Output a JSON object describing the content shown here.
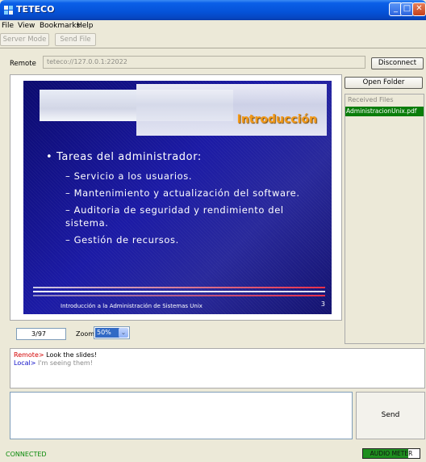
{
  "window": {
    "title": "TETECO",
    "icon": "teteco-app-icon",
    "controls": {
      "minimize": "minimize-icon",
      "maximize": "maximize-icon",
      "close": "close-icon"
    }
  },
  "menu": {
    "items": [
      "File",
      "View",
      "Bookmarks",
      "Help"
    ]
  },
  "toolbar": {
    "server_mode": "Server Mode",
    "send_file": "Send File"
  },
  "connection": {
    "label": "Remote",
    "address": "teteco://127.0.0.1:22022",
    "disconnect": "Disconnect"
  },
  "slide": {
    "title": "Introducción",
    "bullet": "• Tareas del administrador:",
    "subitems": [
      "– Servicio a los usuarios.",
      "– Mantenimiento y actualización del software.",
      "– Auditoria de seguridad y rendimiento del sistema.",
      "– Gestión de recursos."
    ],
    "footer": "Introducción a la Administración de Sistemas Unix",
    "number": "3",
    "colors": {
      "title": "#f39a1a",
      "background": "#1b1aa5"
    }
  },
  "viewer": {
    "page": "3/97",
    "zoom_label": "Zoom:",
    "zoom_value": "50%"
  },
  "files": {
    "open_folder": "Open Folder",
    "header": "Received Files",
    "items": [
      "AdministracionUnix.pdf"
    ]
  },
  "chat": {
    "messages": [
      {
        "sender": "Remote",
        "sep": "> ",
        "text": "Look the slides!"
      },
      {
        "sender": "Local",
        "sep": "> ",
        "text": "I'm seeing them!"
      }
    ]
  },
  "compose": {
    "send_label": "Send"
  },
  "status": {
    "text": "CONNECTED",
    "audio_meter_label": "AUDIO METER",
    "audio_level": 0.8,
    "colors": {
      "connected": "#0a8a0a",
      "meter": "#1f8f1f"
    }
  }
}
